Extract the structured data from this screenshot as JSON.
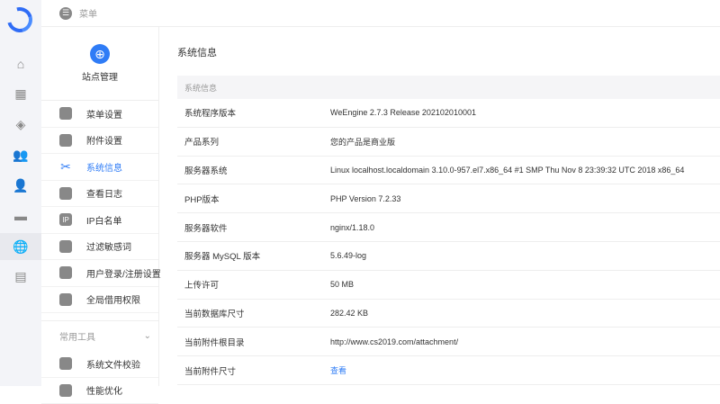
{
  "header": {
    "title": "菜单"
  },
  "rail": {
    "items": [
      {
        "icon": "home-icon"
      },
      {
        "icon": "apps-icon"
      },
      {
        "icon": "module-icon"
      },
      {
        "icon": "users-icon"
      },
      {
        "icon": "user-lock-icon"
      },
      {
        "icon": "monitor-icon"
      },
      {
        "icon": "globe-icon",
        "active": true
      },
      {
        "icon": "store-icon"
      }
    ]
  },
  "sidebar": {
    "site_title": "站点管理",
    "items": [
      {
        "label": "菜单设置",
        "icon": "menu-icon"
      },
      {
        "label": "附件设置",
        "icon": "attachment-icon"
      },
      {
        "label": "系统信息",
        "icon": "tools-icon",
        "active": true
      },
      {
        "label": "查看日志",
        "icon": "log-icon"
      },
      {
        "label": "IP白名单",
        "icon": "ip-icon",
        "icon_text": "IP"
      },
      {
        "label": "过滤敏感词",
        "icon": "filter-icon"
      },
      {
        "label": "用户登录/注册设置",
        "icon": "user-icon"
      },
      {
        "label": "全局借用权限",
        "icon": "permission-icon"
      }
    ],
    "group": {
      "label": "常用工具",
      "items": [
        {
          "label": "系统文件校验",
          "icon": "folder-icon"
        },
        {
          "label": "性能优化",
          "icon": "rocket-icon"
        }
      ]
    }
  },
  "main": {
    "title": "系统信息",
    "table_header": "系统信息",
    "rows": [
      {
        "key": "系统程序版本",
        "value": "WeEngine 2.7.3 Release 202102010001"
      },
      {
        "key": "产品系列",
        "value": "您的产品是商业版"
      },
      {
        "key": "服务器系统",
        "value": "Linux localhost.localdomain 3.10.0-957.el7.x86_64 #1 SMP Thu Nov 8 23:39:32 UTC 2018 x86_64"
      },
      {
        "key": "PHP版本",
        "value": "PHP Version 7.2.33"
      },
      {
        "key": "服务器软件",
        "value": "nginx/1.18.0"
      },
      {
        "key": "服务器 MySQL 版本",
        "value": "5.6.49-log"
      },
      {
        "key": "上传许可",
        "value": "50 MB"
      },
      {
        "key": "当前数据库尺寸",
        "value": "282.42 KB"
      },
      {
        "key": "当前附件根目录",
        "value": "http://www.cs2019.com/attachment/"
      },
      {
        "key": "当前附件尺寸",
        "value": "查看",
        "link": true
      }
    ]
  },
  "colors": {
    "accent": "#2f7cf6",
    "rail_bg": "#f3f4f8"
  }
}
